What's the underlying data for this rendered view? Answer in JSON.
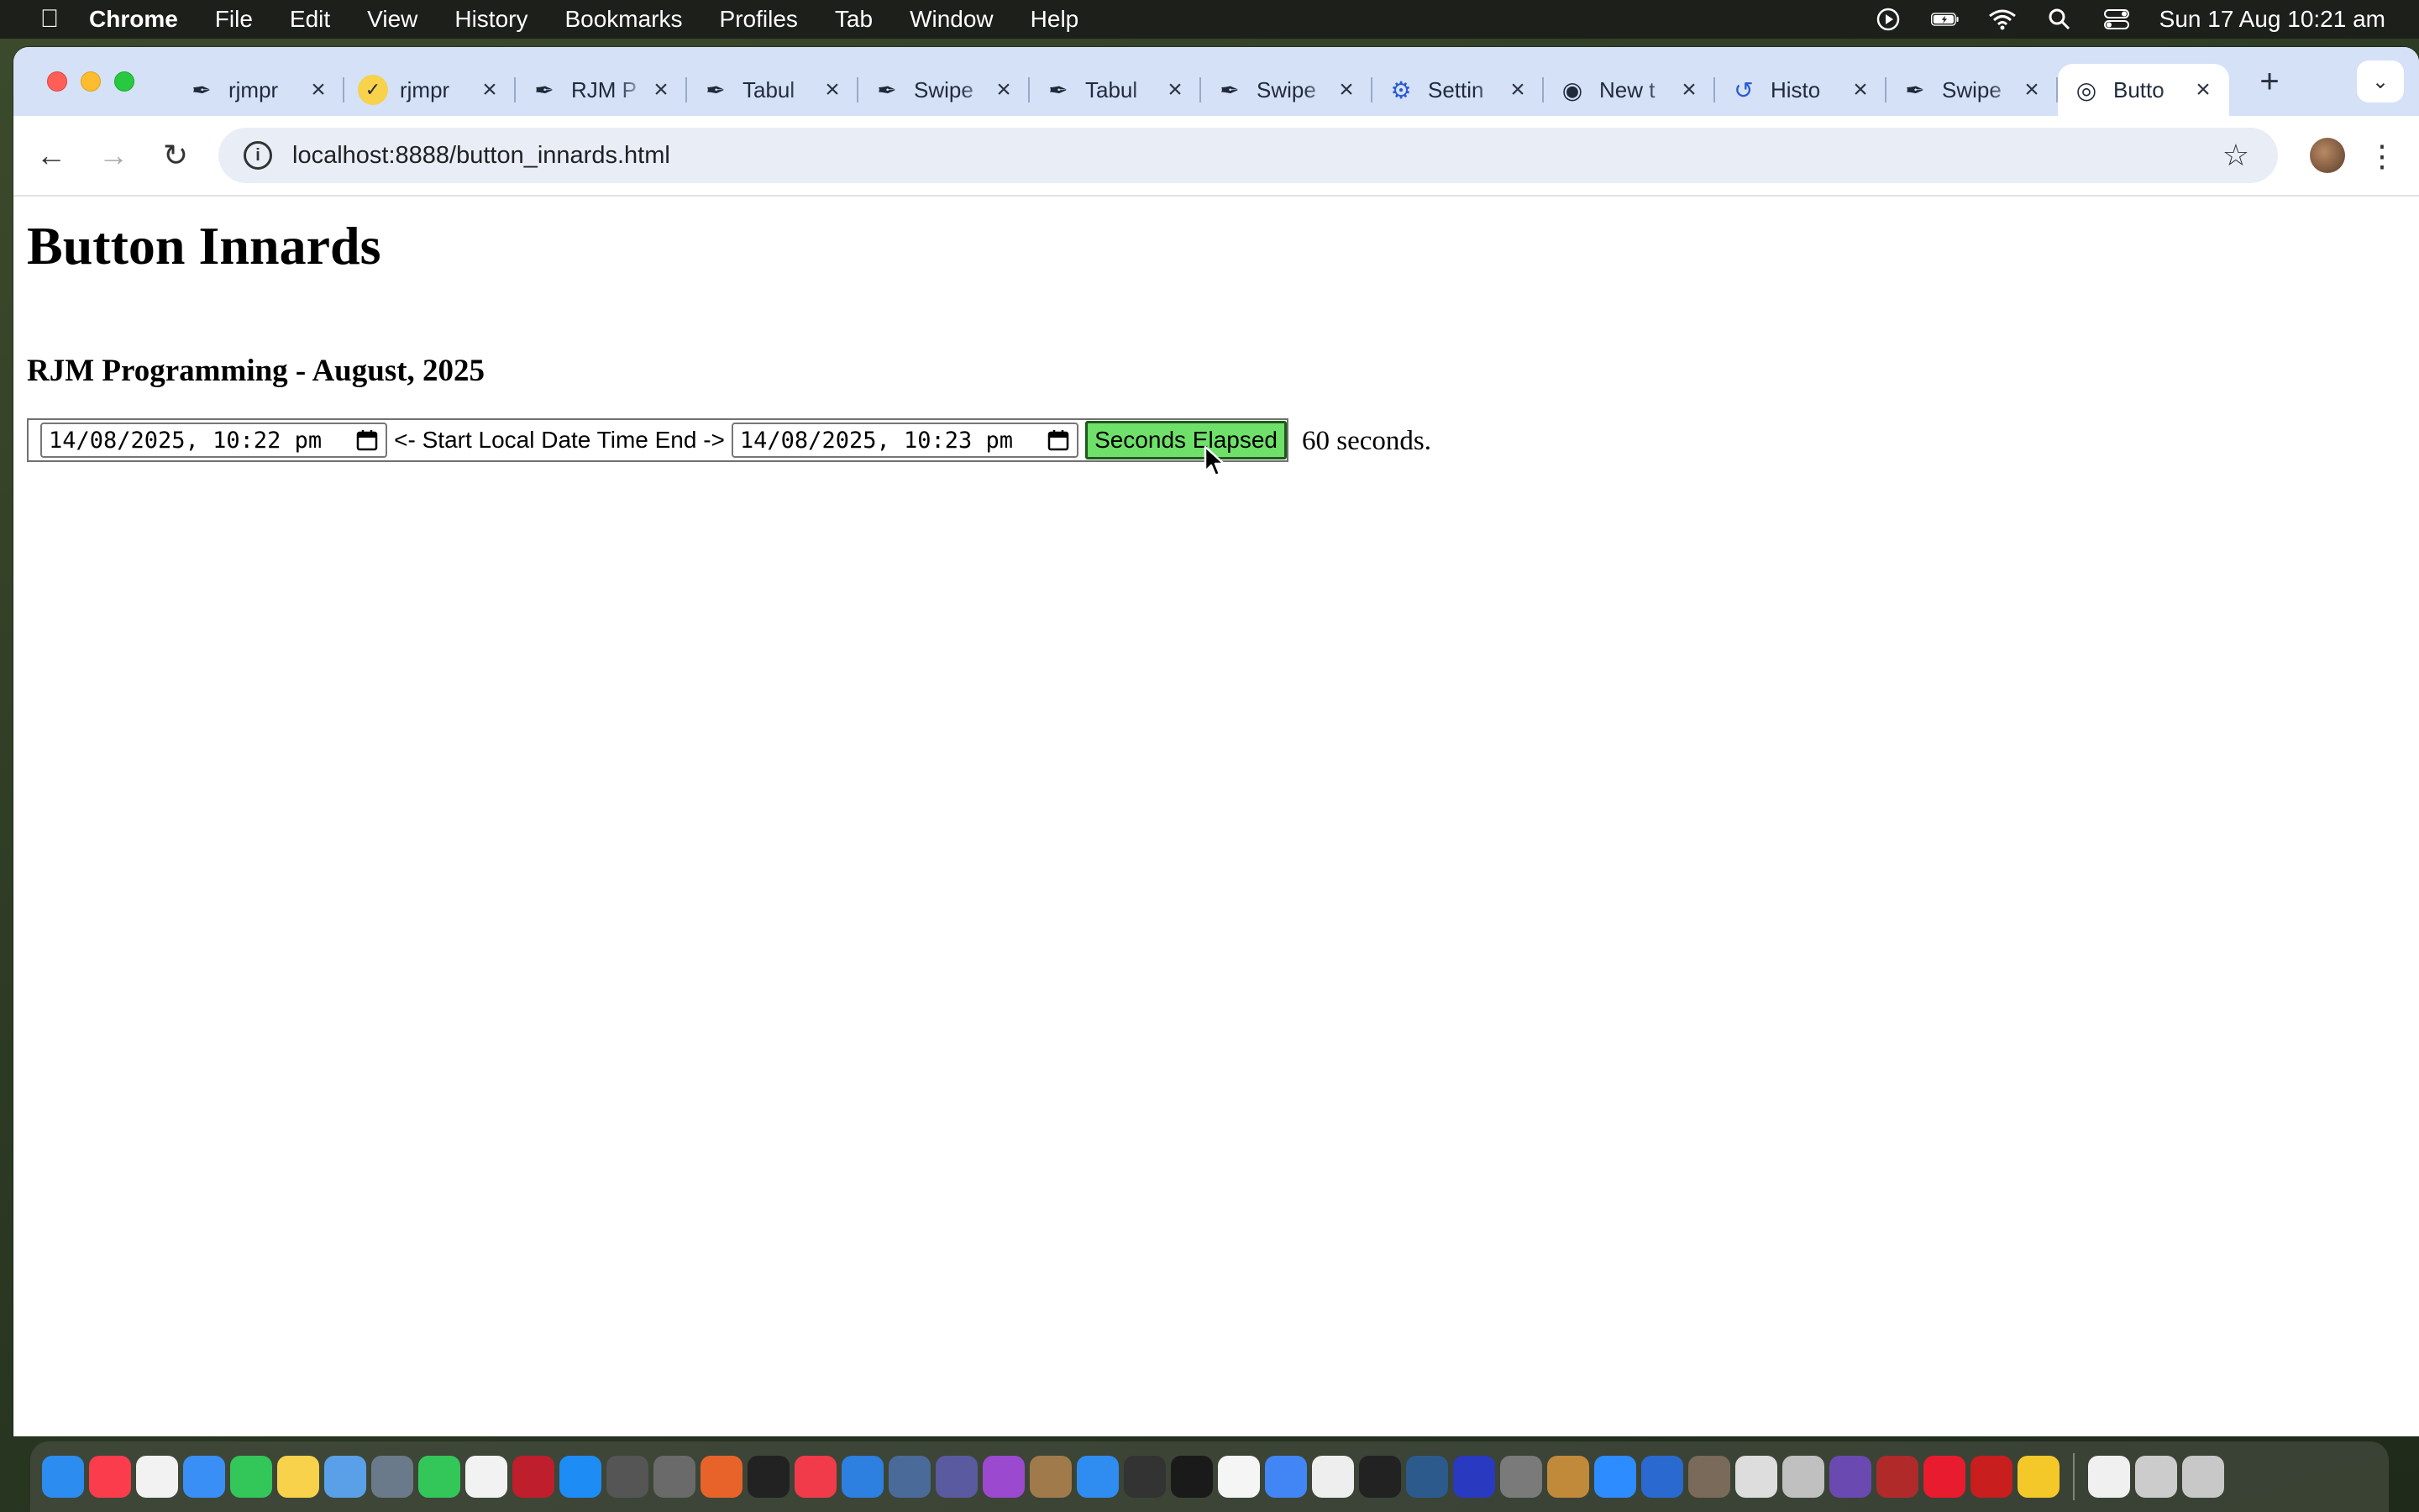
{
  "menubar": {
    "app_name": "Chrome",
    "items": [
      "File",
      "Edit",
      "View",
      "History",
      "Bookmarks",
      "Profiles",
      "Tab",
      "Window",
      "Help"
    ],
    "clock": "Sun 17 Aug  10:21 am"
  },
  "tabs": [
    {
      "title": "rjmpr",
      "icon": "feather-icon"
    },
    {
      "title": "rjmpr",
      "icon": "check-circle-icon"
    },
    {
      "title": "RJM P",
      "icon": "feather-icon"
    },
    {
      "title": "Tabul",
      "icon": "feather-icon"
    },
    {
      "title": "Swipe",
      "icon": "feather-icon"
    },
    {
      "title": "Tabul",
      "icon": "feather-icon"
    },
    {
      "title": "Swipe",
      "icon": "feather-icon"
    },
    {
      "title": "Settin",
      "icon": "gear-icon"
    },
    {
      "title": "New t",
      "icon": "chrome-icon"
    },
    {
      "title": "Histo",
      "icon": "history-icon"
    },
    {
      "title": "Swipe",
      "icon": "feather-icon"
    },
    {
      "title": "Butto",
      "icon": "globe-icon",
      "active": true
    }
  ],
  "toolbar": {
    "url": "localhost:8888/button_innards.html"
  },
  "page": {
    "title": "Button Innards",
    "subtitle": "RJM Programming - August, 2025",
    "start_datetime": "14/08/2025, 10:22 pm",
    "label_between": "<- Start Local Date Time End ->",
    "end_datetime": "14/08/2025, 10:23 pm",
    "button_label": "Seconds Elapsed",
    "result_text": "60 seconds."
  },
  "colors": {
    "tabstrip": "#d4e1f7",
    "button_bg": "#6fe06a",
    "button_border": "#1e5a1c"
  },
  "dock": {
    "apps": [
      {
        "name": "finder",
        "color": "#2d8cf0"
      },
      {
        "name": "music",
        "color": "#fa3c4c"
      },
      {
        "name": "reminders",
        "color": "#f2f2f2"
      },
      {
        "name": "mail",
        "color": "#3a8ff7"
      },
      {
        "name": "messages",
        "color": "#33c759"
      },
      {
        "name": "notes",
        "color": "#f7d24a"
      },
      {
        "name": "preview",
        "color": "#5aa0e8"
      },
      {
        "name": "launchpad",
        "color": "#6a7a8a"
      },
      {
        "name": "facetime",
        "color": "#33c759"
      },
      {
        "name": "textedit",
        "color": "#f2f2f2"
      },
      {
        "name": "filezilla",
        "color": "#bf1e2d"
      },
      {
        "name": "app-store",
        "color": "#1e8cf5"
      },
      {
        "name": "calculator",
        "color": "#555555"
      },
      {
        "name": "utility",
        "color": "#6a6a6a"
      },
      {
        "name": "firefox",
        "color": "#e8632a"
      },
      {
        "name": "apple-tv",
        "color": "#222222"
      },
      {
        "name": "news",
        "color": "#f23b4a"
      },
      {
        "name": "xcode",
        "color": "#2d7fe0"
      },
      {
        "name": "system-info",
        "color": "#4a6a9a"
      },
      {
        "name": "bbedit",
        "color": "#5a5aa0"
      },
      {
        "name": "podcasts",
        "color": "#9b4ad0"
      },
      {
        "name": "contacts",
        "color": "#a07a4a"
      },
      {
        "name": "safari",
        "color": "#2f8cf0"
      },
      {
        "name": "activity",
        "color": "#333333"
      },
      {
        "name": "terminal",
        "color": "#1a1a1a"
      },
      {
        "name": "calendar",
        "color": "#f5f5f5"
      },
      {
        "name": "chrome",
        "color": "#4285f4"
      },
      {
        "name": "file",
        "color": "#eeeeee"
      },
      {
        "name": "console",
        "color": "#222222"
      },
      {
        "name": "quicktime",
        "color": "#2c5a8c"
      },
      {
        "name": "intellij",
        "color": "#2a3ac0"
      },
      {
        "name": "settings",
        "color": "#7a7a7a"
      },
      {
        "name": "paint",
        "color": "#c08a3a"
      },
      {
        "name": "zoom",
        "color": "#2d8cff"
      },
      {
        "name": "affinity",
        "color": "#2a6ad0"
      },
      {
        "name": "gimp",
        "color": "#7a6a5a"
      },
      {
        "name": "tableplus",
        "color": "#dddddd"
      },
      {
        "name": "notability",
        "color": "#c0c0c0"
      },
      {
        "name": "retcon",
        "color": "#6a4ab0"
      },
      {
        "name": "compass",
        "color": "#b02a2a"
      },
      {
        "name": "opera",
        "color": "#e81c2e"
      },
      {
        "name": "pdf",
        "color": "#c81e1e"
      },
      {
        "name": "bulb",
        "color": "#f5c82a"
      },
      {
        "name": "document",
        "color": "#f0f0f0"
      },
      {
        "name": "downloads",
        "color": "#cccccc"
      },
      {
        "name": "trash",
        "color": "#c8c8c8"
      }
    ]
  }
}
